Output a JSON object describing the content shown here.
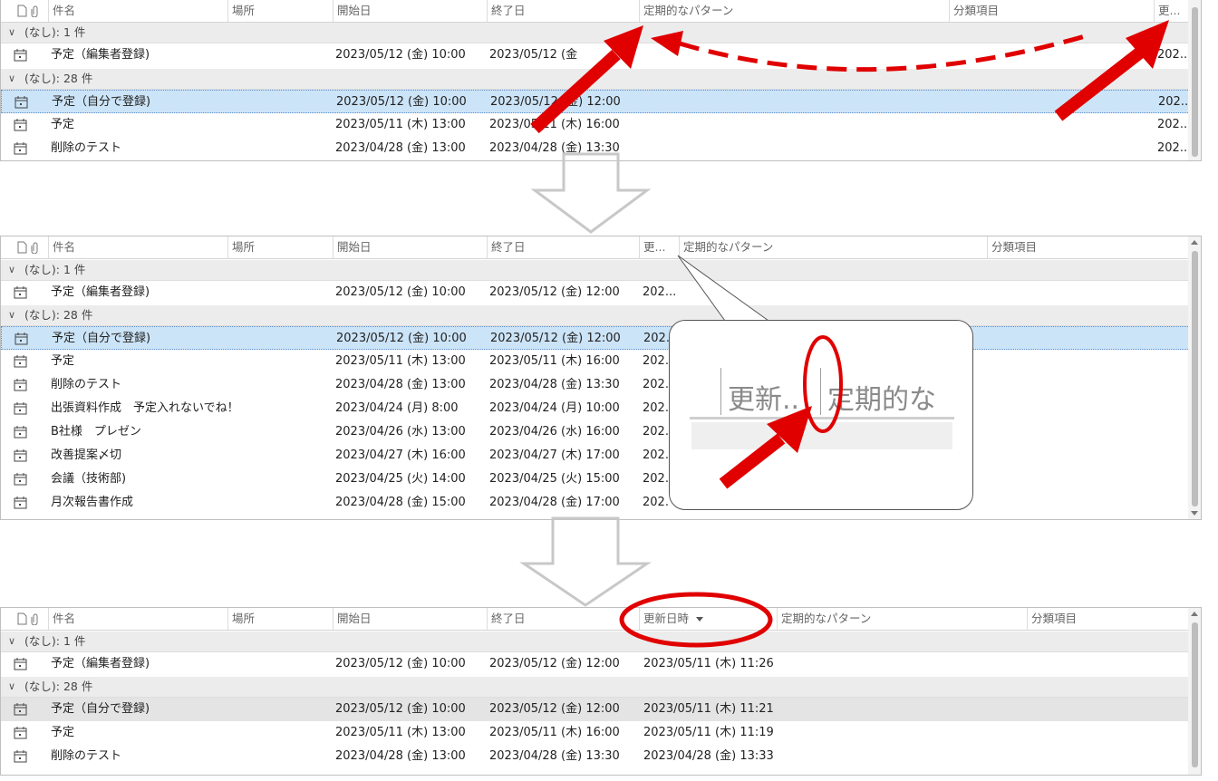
{
  "colors": {
    "selection": "#cce4f7",
    "group_bg": "#ececec",
    "annotation_red": "#e00000",
    "arrow_gray": "#c0c0c0"
  },
  "panel1": {
    "headers": {
      "subject": "件名",
      "location": "場所",
      "start": "開始日",
      "end": "終了日",
      "recurrence": "定期的なパターン",
      "categories": "分類項目",
      "modified": "更..."
    },
    "group1": "(なし): 1 件",
    "group2": "(なし): 28 件",
    "rows": [
      {
        "subject": "予定（編集者登録)",
        "start": "2023/05/12 (金) 10:00",
        "end": "2023/05/12 (金",
        "modified": "202..."
      },
      {
        "subject": "予定（自分で登録)",
        "start": "2023/05/12 (金) 10:00",
        "end": "2023/05/12 (金) 12:00",
        "modified": "202..."
      },
      {
        "subject": "予定",
        "start": "2023/05/11 (木) 13:00",
        "end": "2023/05/11 (木) 16:00",
        "modified": "202..."
      },
      {
        "subject": "削除のテスト",
        "start": "2023/04/28 (金) 13:00",
        "end": "2023/04/28 (金) 13:30",
        "modified": "202..."
      }
    ]
  },
  "panel2": {
    "headers": {
      "subject": "件名",
      "location": "場所",
      "start": "開始日",
      "end": "終了日",
      "modified": "更...",
      "recurrence": "定期的なパターン",
      "categories": "分類項目"
    },
    "group1": "(なし): 1 件",
    "group2": "(なし): 28 件",
    "rows": [
      {
        "subject": "予定（編集者登録)",
        "start": "2023/05/12 (金) 10:00",
        "end": "2023/05/12 (金) 12:00",
        "modified": "202..."
      },
      {
        "subject": "予定（自分で登録)",
        "start": "2023/05/12 (金) 10:00",
        "end": "2023/05/12 (金) 12:00",
        "modified": "202."
      },
      {
        "subject": "予定",
        "start": "2023/05/11 (木) 13:00",
        "end": "2023/05/11 (木) 16:00",
        "modified": "202."
      },
      {
        "subject": "削除のテスト",
        "start": "2023/04/28 (金) 13:00",
        "end": "2023/04/28 (金) 13:30",
        "modified": "202."
      },
      {
        "subject": "出張資料作成　予定入れないでね！",
        "start": "2023/04/24 (月) 8:00",
        "end": "2023/04/24 (月) 10:00",
        "modified": "202."
      },
      {
        "subject": "B社様　プレゼン",
        "start": "2023/04/26 (水) 13:00",
        "end": "2023/04/26 (水) 16:00",
        "modified": "202."
      },
      {
        "subject": "改善提案〆切",
        "start": "2023/04/27 (木) 16:00",
        "end": "2023/04/27 (木) 17:00",
        "modified": "202."
      },
      {
        "subject": "会議（技術部)",
        "start": "2023/04/25 (火) 14:00",
        "end": "2023/04/25 (火) 15:00",
        "modified": "202."
      },
      {
        "subject": "月次報告書作成",
        "start": "2023/04/28 (金) 15:00",
        "end": "2023/04/28 (金) 17:00",
        "modified": "202."
      }
    ],
    "zoom": {
      "left": "更新..",
      "right": "定期的な"
    }
  },
  "panel3": {
    "headers": {
      "subject": "件名",
      "location": "場所",
      "start": "開始日",
      "end": "終了日",
      "modified": "更新日時",
      "recurrence": "定期的なパターン",
      "categories": "分類項目"
    },
    "group1": "(なし): 1 件",
    "group2": "(なし): 28 件",
    "rows": [
      {
        "subject": "予定（編集者登録)",
        "start": "2023/05/12 (金) 10:00",
        "end": "2023/05/12 (金) 12:00",
        "modified": "2023/05/11 (木) 11:26"
      },
      {
        "subject": "予定（自分で登録)",
        "start": "2023/05/12 (金) 10:00",
        "end": "2023/05/12 (金) 12:00",
        "modified": "2023/05/11 (木) 11:21"
      },
      {
        "subject": "予定",
        "start": "2023/05/11 (木) 13:00",
        "end": "2023/05/11 (木) 16:00",
        "modified": "2023/05/11 (木) 11:19"
      },
      {
        "subject": "削除のテスト",
        "start": "2023/04/28 (金) 13:00",
        "end": "2023/04/28 (金) 13:30",
        "modified": "2023/04/28 (金) 13:33"
      }
    ]
  }
}
